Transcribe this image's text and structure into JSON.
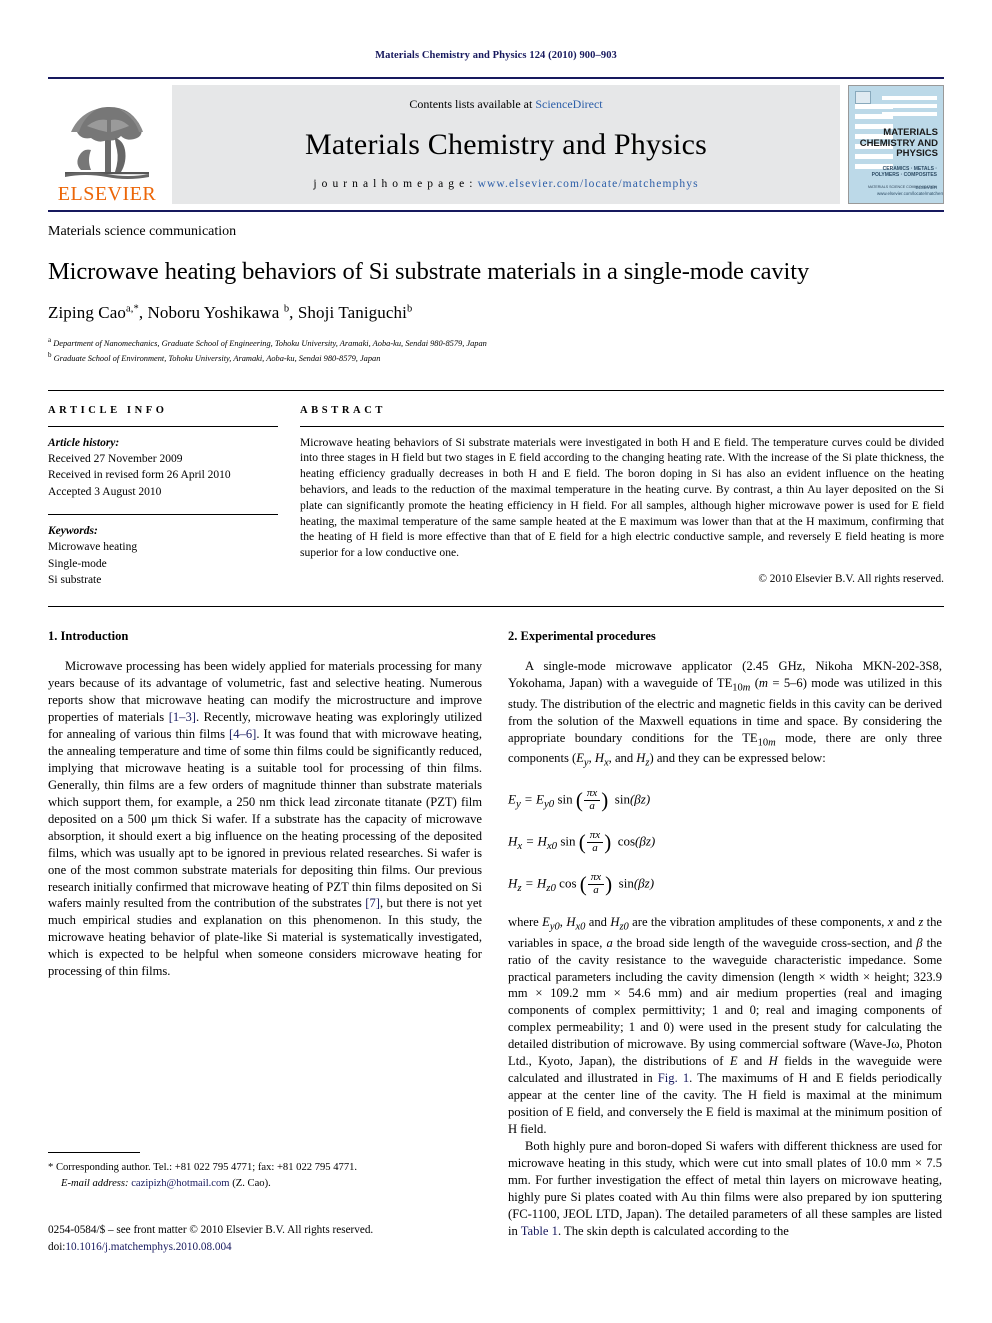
{
  "running_head": "Materials Chemistry and Physics 124 (2010) 900–903",
  "masthead": {
    "contents_prefix": "Contents lists available at ",
    "contents_link": "ScienceDirect",
    "journal_title": "Materials Chemistry and Physics",
    "homepage_label": "j o u r n a l   h o m e p a g e :",
    "homepage_url": "www.elsevier.com/locate/matchemphys",
    "publisher_name": "ELSEVIER",
    "cover": {
      "title": "MATERIALS CHEMISTRY AND PHYSICS",
      "subtitle": "CERAMICS · METALS · POLYMERS · COMPOSITES",
      "sub_note": "MATERIALS SCIENCE COMMUNICATION",
      "imprint": "ELSEVIER www.elsevier.com/locate/matchemphys"
    },
    "link_color": "#2b5ea8",
    "rule_color": "#17195e",
    "band_bg": "#e6e7e8",
    "elsevier_orange": "#ec6608"
  },
  "article": {
    "doctype": "Materials science communication",
    "title": "Microwave heating behaviors of Si substrate materials in a single-mode cavity",
    "authors_html": "Ziping Cao<sup>a,*</sup>, Noboru Yoshikawa <sup>b</sup>, Shoji Taniguchi<sup>b</sup>",
    "affiliations": [
      "Department of Nanomechanics, Graduate School of Engineering, Tohoku University, Aramaki, Aoba-ku, Sendai 980-8579, Japan",
      "Graduate School of Environment, Tohoku University, Aramaki, Aoba-ku, Sendai 980-8579, Japan"
    ],
    "affil_marks": [
      "a",
      "b"
    ]
  },
  "article_info": {
    "heading": "ARTICLE INFO",
    "history_label": "Article history:",
    "history": [
      "Received 27 November 2009",
      "Received in revised form 26 April 2010",
      "Accepted 3 August 2010"
    ],
    "keywords_label": "Keywords:",
    "keywords": [
      "Microwave heating",
      "Single-mode",
      "Si substrate"
    ]
  },
  "abstract": {
    "heading": "ABSTRACT",
    "text": "Microwave heating behaviors of Si substrate materials were investigated in both H and E field. The temperature curves could be divided into three stages in H field but two stages in E field according to the changing heating rate. With the increase of the Si plate thickness, the heating efficiency gradually decreases in both H and E field. The boron doping in Si has also an evident influence on the heating behaviors, and leads to the reduction of the maximal temperature in the heating curve. By contrast, a thin Au layer deposited on the Si plate can significantly promote the heating efficiency in H field. For all samples, although higher microwave power is used for E field heating, the maximal temperature of the same sample heated at the E maximum was lower than that at the H maximum, confirming that the heating of H field is more effective than that of E field for a high electric conductive sample, and reversely E field heating is more superior for a low conductive one.",
    "copyright": "© 2010 Elsevier B.V. All rights reserved."
  },
  "sections": {
    "intro": {
      "heading": "1.  Introduction",
      "p1_a": "Microwave processing has been widely applied for materials processing for many years because of its advantage of volumetric, fast and selective heating. Numerous reports show that microwave heating can modify the microstructure and improve properties of materials ",
      "ref1": "[1–3]",
      "p1_b": ". Recently, microwave heating was exploringly utilized for annealing of various thin films ",
      "ref2": "[4–6]",
      "p1_c": ". It was found that with microwave heating, the annealing temperature and time of some thin films could be significantly reduced, implying that microwave heating is a suitable tool for processing of thin films. Generally, thin films are a few orders of magnitude thinner than substrate materials which support them, for example, a 250 nm thick lead zirconate titanate (PZT) film deposited on a 500 μm thick Si wafer. If a substrate has the capacity of microwave absorption, it should exert a big influence on the heating processing of the deposited films, which was usually apt to be ignored in previous related researches. Si wafer is one of the most common substrate materials for depositing thin films. Our previous research initially confirmed that microwave heating of PZT thin films deposited on Si wafers mainly resulted from the contribution of the substrates ",
      "ref3": "[7]",
      "p1_d": ", but there is not yet much empirical studies and explanation on this phenomenon. In this study, the microwave heating behavior of plate-like Si material is systematically investigated, which is expected to be helpful when someone considers microwave heating for processing of thin films."
    },
    "experimental": {
      "heading": "2.  Experimental procedures",
      "p1_html": "A single-mode microwave applicator (2.45 GHz, Nikoha MKN-202-3S8, Yokohama, Japan) with a waveguide of TE<sub>10<i>m</i></sub> (<i>m</i> = 5–6) mode was utilized in this study. The distribution of the electric and magnetic fields in this cavity can be derived from the solution of the Maxwell equations in time and space. By considering the appropriate boundary conditions for the TE<sub>10<i>m</i></sub> mode, there are only three components (<i>E<sub>y</sub></i>, <i>H<sub>x</sub></i>, and <i>H<sub>z</sub></i>) and they can be expressed below:",
      "eq1": "Ey = Ey0 sin(πx/a) sin(βz)",
      "eq2": "Hx = Hx0 sin(πx/a) cos(βz)",
      "eq3": "Hz = Hz0 cos(πx/a) sin(βz)",
      "p2_html": "where <i>E<sub>y0</sub></i>, <i>H<sub>x0</sub></i> and <i>H<sub>z0</sub></i> are the vibration amplitudes of these components, <i>x</i> and <i>z</i> the variables in space, <i>a</i> the broad side length of the waveguide cross-section, and <i>β</i> the ratio of the cavity resistance to the waveguide characteristic impedance. Some practical parameters including the cavity dimension (length × width × height; 323.9 mm × 109.2 mm × 54.6 mm) and air medium properties (real and imaging components of complex permittivity; 1 and 0; real and imaging components of complex permeability; 1 and 0) were used in the present study for calculating the detailed distribution of microwave. By using commercial software (Wave-Jω, Photon Ltd., Kyoto, Japan), the distributions of <i>E</i> and <i>H</i> fields in the waveguide were calculated and illustrated in ",
      "fig_ref": "Fig. 1",
      "p2_b": ". The maximums of H and E fields periodically appear at the center line of the cavity. The H field is maximal at the minimum position of E field, and conversely the E field is maximal at the minimum position of H field.",
      "p3_a": "Both highly pure and boron-doped Si wafers with different thickness are used for microwave heating in this study, which were cut into small plates of 10.0 mm × 7.5 mm. For further investigation the effect of metal thin layers on microwave heating, highly pure Si plates coated with Au thin films were also prepared by ion sputtering (FC-1100, JEOL LTD, Japan). The detailed parameters of all these samples are listed in ",
      "table_ref": "Table 1",
      "p3_b": ". The skin depth is calculated according to the"
    }
  },
  "footnote": {
    "star": "*",
    "corresponding": " Corresponding author. Tel.: +81 022 795 4771; fax: +81 022 795 4771.",
    "email_label": "E-mail address:",
    "email": "cazipizh@hotmail.com",
    "email_owner": "(Z. Cao)."
  },
  "imprint": {
    "line1": "0254-0584/$ – see front matter © 2010 Elsevier B.V. All rights reserved.",
    "doi_label": "doi:",
    "doi": "10.1016/j.matchemphys.2010.08.004"
  }
}
